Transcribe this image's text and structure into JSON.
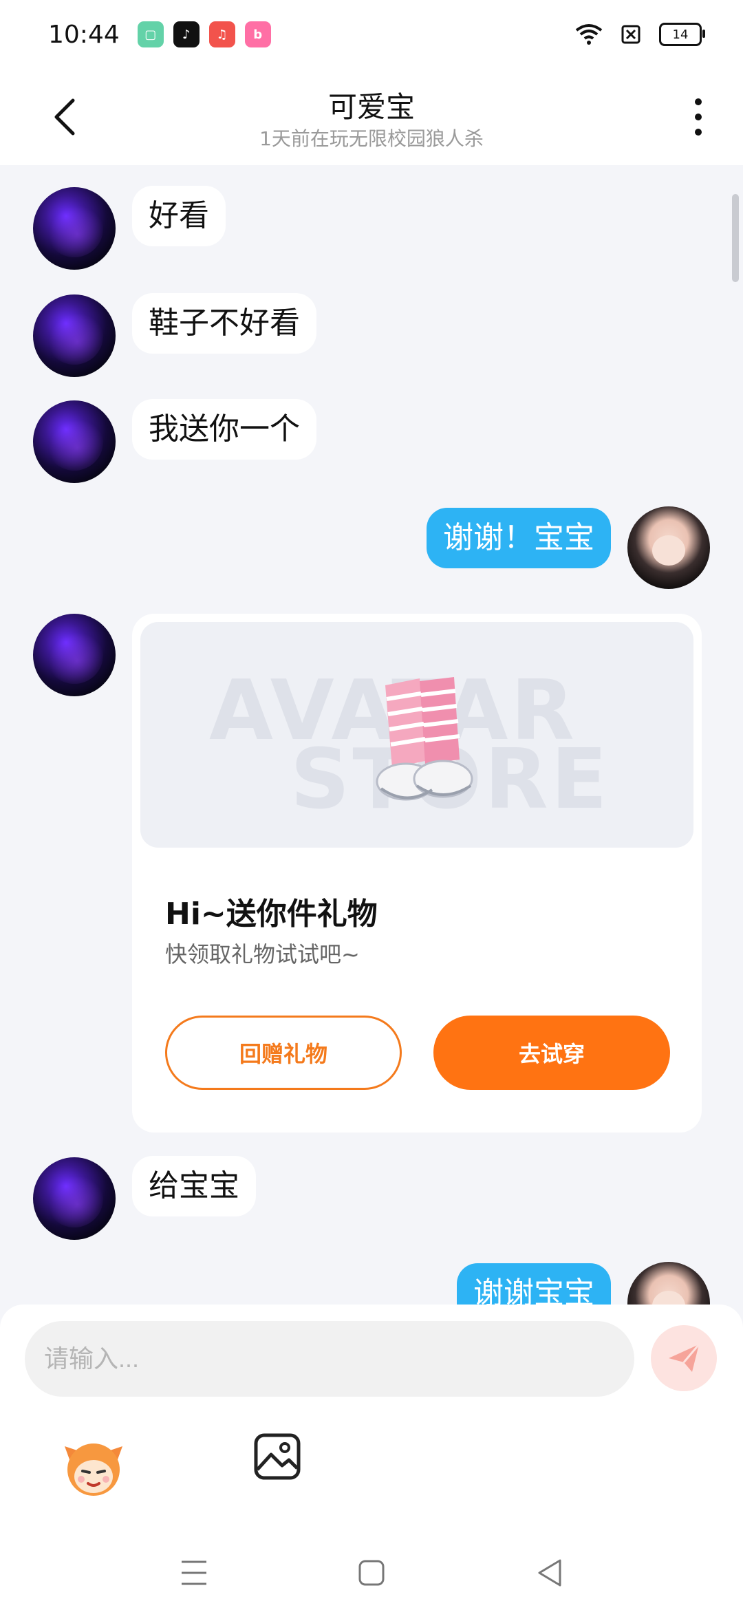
{
  "status_bar": {
    "time": "10:44",
    "battery": "14",
    "apps": [
      {
        "name": "green-app-icon",
        "color": "#63d2a8",
        "glyph": "▢"
      },
      {
        "name": "tiktok-icon",
        "color": "#111111",
        "glyph": "♪"
      },
      {
        "name": "music-app-icon",
        "color": "#f2534c",
        "glyph": "♫"
      },
      {
        "name": "bilibili-icon",
        "color": "#ff6fa5",
        "glyph": "b"
      }
    ]
  },
  "header": {
    "title": "可爱宝",
    "subtitle": "1天前在玩无限校园狼人杀"
  },
  "messages": {
    "m1": "好看",
    "m2": "鞋子不好看",
    "m3": "我送你一个",
    "m4": "谢谢！宝宝",
    "m5": "给宝宝",
    "m6": "谢谢宝宝"
  },
  "gift_card": {
    "watermark_top": "AVATAR",
    "watermark_bottom": "STORE",
    "title": "Hi~送你件礼物",
    "description": "快领取礼物试试吧~",
    "return_label": "回赠礼物",
    "tryon_label": "去试穿"
  },
  "input": {
    "placeholder": "请输入..."
  },
  "colors": {
    "accent_blue": "#2db3f4",
    "accent_orange": "#ff7312"
  }
}
